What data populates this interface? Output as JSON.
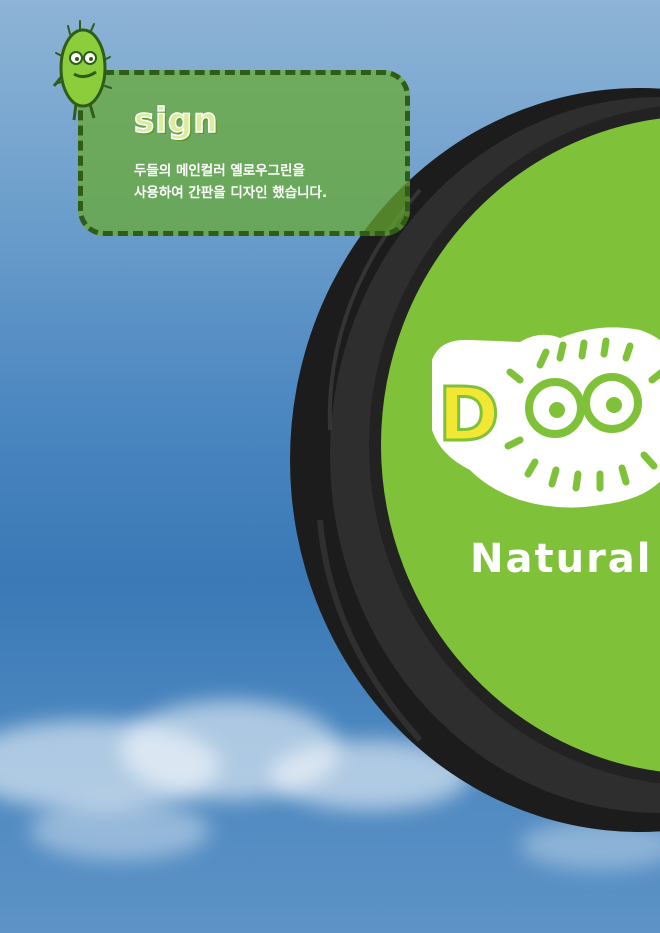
{
  "info_card": {
    "title": "sign",
    "line1": "두들의 메인컬러 옐로우그린을",
    "line2": "사용하여 간판을 디자인 했습니다."
  },
  "signboard": {
    "logo_letter": "D",
    "caption": "Natural"
  },
  "colors": {
    "sky_top": "#8eb4d6",
    "sky_bottom": "#3a79b6",
    "sign_face": "#7fc23a",
    "sign_rim": "#2a2a2a",
    "card_fill": "#68aa30",
    "card_border": "#2f5d18",
    "logo_yellow": "#f2e833"
  },
  "icons": {
    "mascot": "fuzzy-green-monster-icon",
    "logo_character": "fuzzy-eyes-creature-icon"
  }
}
